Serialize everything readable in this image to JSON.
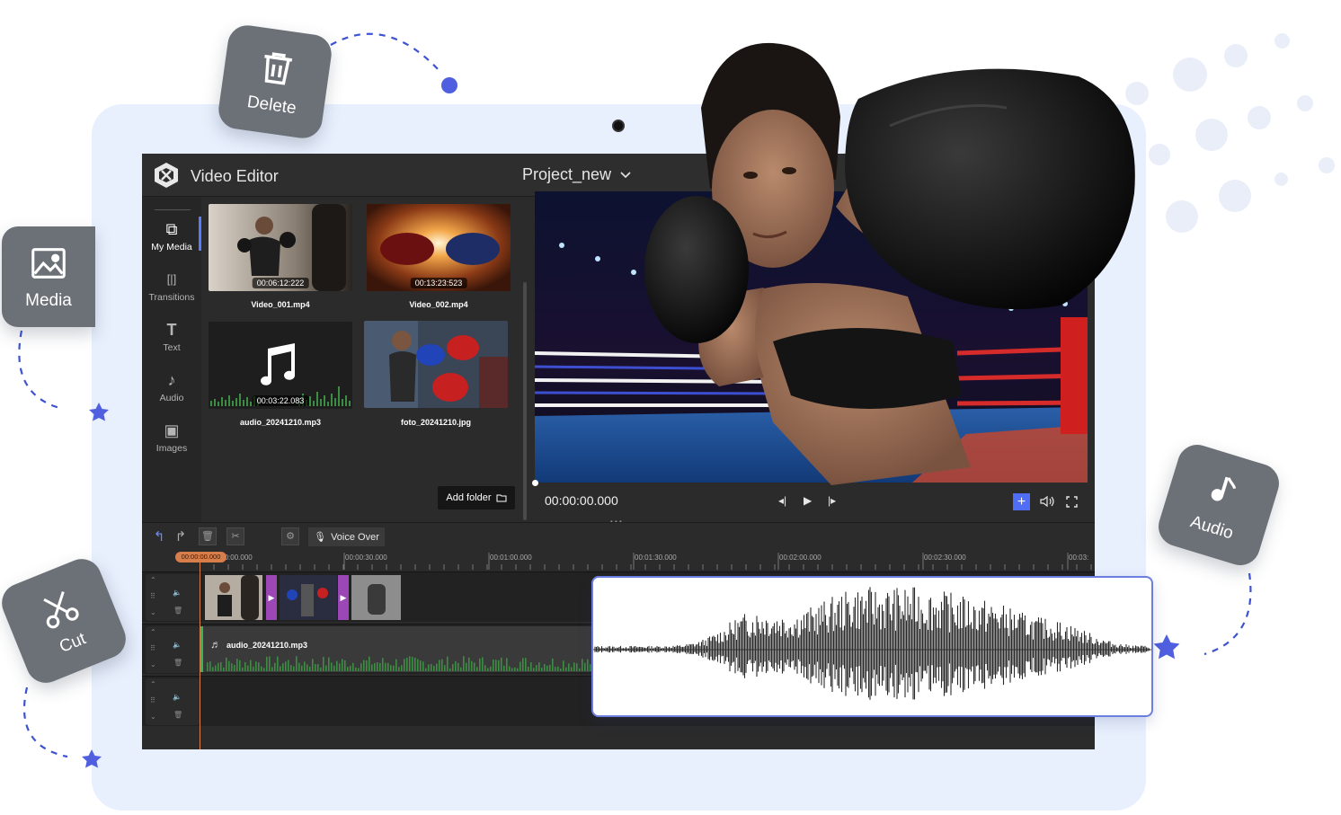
{
  "app": {
    "title": "Video Editor",
    "project": "Project_new"
  },
  "colors": {
    "accent": "#5b7cfa",
    "panel_bg": "#e8f0fe",
    "tile": "#6c7077",
    "playhead": "#d87e4a",
    "star": "#4f5fe0",
    "transition": "#9c47b6",
    "audio_wave": "#3fb34f"
  },
  "floating": {
    "delete": {
      "label": "Delete",
      "icon": "trash-icon"
    },
    "media": {
      "label": "Media",
      "icon": "image-icon"
    },
    "cut": {
      "label": "Cut",
      "icon": "scissors-icon"
    },
    "audio": {
      "label": "Audio",
      "icon": "music-note-icon"
    }
  },
  "sidebar": {
    "items": [
      {
        "label": "My Media",
        "icon": "media-icon",
        "glyph": "⧉"
      },
      {
        "label": "Transitions",
        "icon": "transitions-icon",
        "glyph": "[|]"
      },
      {
        "label": "Text",
        "icon": "text-icon",
        "glyph": "T"
      },
      {
        "label": "Audio",
        "icon": "audio-icon",
        "glyph": "♪"
      },
      {
        "label": "Images",
        "icon": "images-icon",
        "glyph": "▣"
      }
    ]
  },
  "media": {
    "items": [
      {
        "name": "Video_001.mp4",
        "duration": "00:06:12:222"
      },
      {
        "name": "Video_002.mp4",
        "duration": "00:13:23:523"
      },
      {
        "name": "audio_20241210.mp3",
        "duration": "00:03:22.083"
      },
      {
        "name": "foto_20241210.jpg"
      }
    ],
    "add_folder": "Add folder"
  },
  "preview": {
    "timecode": "00:00:00.000",
    "plus": "+"
  },
  "timeline": {
    "voice_over": "Voice Over",
    "playhead_time": "00:00:00.000",
    "ruler": [
      "00:00:00.000",
      "00:00:30.000",
      "00:01:00.000",
      "00:01:30.000",
      "00:02:00.000",
      "00:02:30.000",
      "00:03:"
    ],
    "audio_clip_name": "audio_20241210.mp3"
  }
}
